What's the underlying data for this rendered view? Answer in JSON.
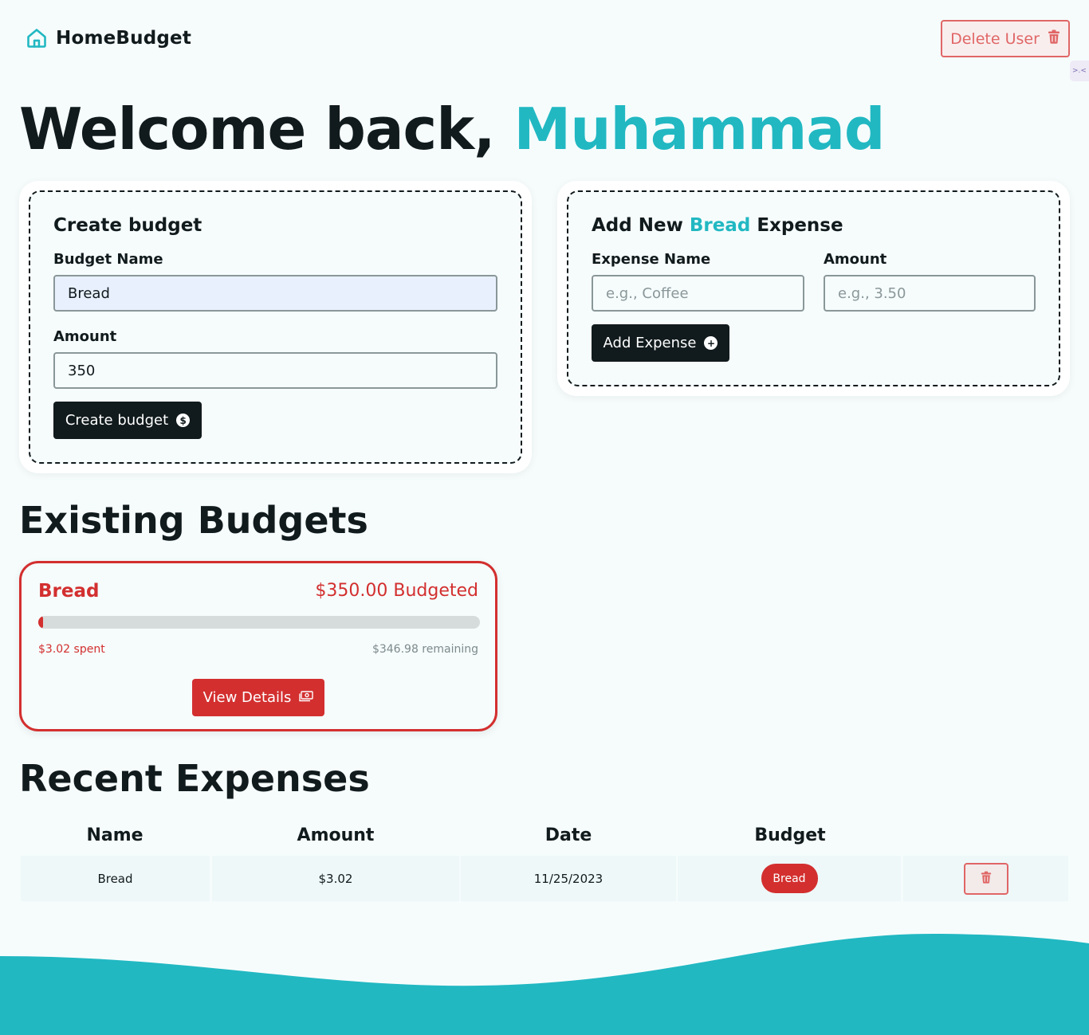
{
  "app": {
    "brand": "HomeBudget"
  },
  "header": {
    "delete_user_label": "Delete User",
    "side_tab": ">.<"
  },
  "welcome": {
    "prefix": "Welcome back, ",
    "user_name": "Muhammad"
  },
  "create_budget": {
    "title": "Create budget",
    "name_label": "Budget Name",
    "name_value": "Bread",
    "amount_label": "Amount",
    "amount_value": "350",
    "submit_label": "Create budget"
  },
  "add_expense": {
    "title_prefix": "Add New ",
    "title_budget": "Bread",
    "title_suffix": " Expense",
    "name_label": "Expense Name",
    "name_placeholder": "e.g., Coffee",
    "amount_label": "Amount",
    "amount_placeholder": "e.g., 3.50",
    "submit_label": "Add Expense"
  },
  "existing_budgets": {
    "heading": "Existing Budgets",
    "items": [
      {
        "name": "Bread",
        "budgeted": "$350.00 Budgeted",
        "spent": "$3.02 spent",
        "remaining": "$346.98 remaining",
        "progress_fraction": 0.0086,
        "view_label": "View Details"
      }
    ]
  },
  "recent_expenses": {
    "heading": "Recent Expenses",
    "columns": [
      "Name",
      "Amount",
      "Date",
      "Budget"
    ],
    "rows": [
      {
        "name": "Bread",
        "amount": "$3.02",
        "date": "11/25/2023",
        "budget": "Bread"
      }
    ]
  },
  "colors": {
    "accent": "#21b8c2",
    "danger": "#d32f2f",
    "dark": "#111a1c",
    "background": "#f6fcfc"
  }
}
